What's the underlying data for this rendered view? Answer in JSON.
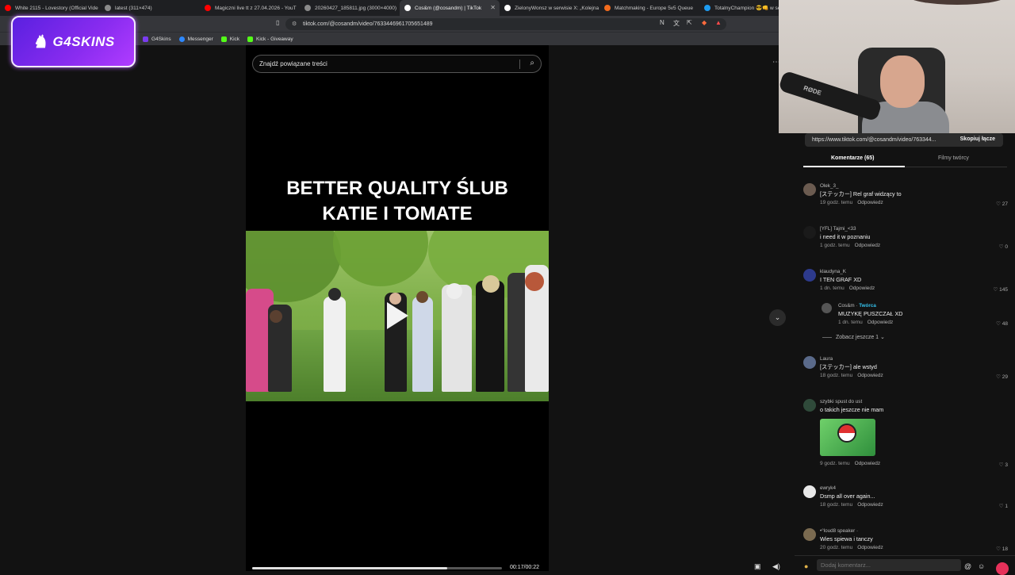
{
  "browser": {
    "tabs": [
      {
        "label": "White 2115 - Lovestory (Official Vide",
        "color": "#ff0000",
        "active": false
      },
      {
        "label": "latest (311×474)",
        "color": "#8a8a8a",
        "active": false
      },
      {
        "label": "Magiczni live tt z 27.04.2026 - YouT",
        "color": "#ff0000",
        "active": false
      },
      {
        "label": "20260427_185811.jpg (3000×4000)",
        "color": "#8a8a8a",
        "active": false
      },
      {
        "label": "Cos&m (@cosandm) | TikTok",
        "color": "#ffffff",
        "active": true
      },
      {
        "label": "ZielonyWonsz w serwisie X: „Kolejna",
        "color": "#ffffff",
        "active": false
      },
      {
        "label": "Matchmaking - Europe 5v5 Queue",
        "color": "#f26b1d",
        "active": false
      },
      {
        "label": "TotalnyChampion 😎👊 w se",
        "color": "#1d9bf0",
        "active": false
      }
    ],
    "url": "tiktok.com/@cosandm/video/7633446961705651489",
    "bookmarks": [
      {
        "label": "G4Skins",
        "color": "#7a3cf0"
      },
      {
        "label": "Messenger",
        "color": "#2d88ff"
      },
      {
        "label": "Kick",
        "color": "#53fc18"
      },
      {
        "label": "Kick - Giveaway",
        "color": "#53fc18"
      }
    ]
  },
  "overlay": {
    "logo_text": "G4SKINS"
  },
  "video": {
    "search_placeholder": "Znajdź powiązane treści",
    "title_line1": "BETTER QUALITY ŚLUB",
    "title_line2": "KATIE I TOMATE",
    "time": "00:17/00:22",
    "progress": 0.78
  },
  "panel": {
    "link_url": "https://www.tiktok.com/@cosandm/video/763344...",
    "copy_label": "Skopiuj łącze",
    "tab_comments": "Komentarze (65)",
    "tab_creator": "Filmy twórcy",
    "reply_label": "Odpowiedz",
    "more_replies": "Zobacz jeszcze 1",
    "comment_placeholder": "Dodaj komentarz..."
  },
  "comments": [
    {
      "user": "Olek_3_",
      "text": "[ステッカー] Rel graf widzący to",
      "time": "19 godz. temu",
      "likes": "27"
    },
    {
      "user": "[YFL] Tajmi_<33",
      "text": "i need it w poznaniu",
      "time": "1 godz. temu",
      "likes": "0"
    },
    {
      "user": "klaudyna_K",
      "text": "I TEN GRAF XD",
      "time": "1 dn. temu",
      "likes": "145"
    },
    {
      "user": "Cos&m",
      "badge": "Twórca",
      "text": "MUZYKĘ PUSZCZAŁ XD",
      "time": "1 dn. temu",
      "likes": "48"
    },
    {
      "user": "Laura",
      "text": "[ステッカー] ale wstyd",
      "time": "18 godz. temu",
      "likes": "29"
    },
    {
      "user": "szybki spust do ust",
      "text": "o takich jeszcze nie mam",
      "time": "9 godz. temu",
      "likes": "3"
    },
    {
      "user": "ewryk4",
      "text": "Dsmp all over again...",
      "time": "18 godz. temu",
      "likes": "1"
    },
    {
      "user": "•°loud8 speaker ·",
      "text": "Wies spiewa i tanczy",
      "time": "20 godz. temu",
      "likes": "18"
    }
  ]
}
